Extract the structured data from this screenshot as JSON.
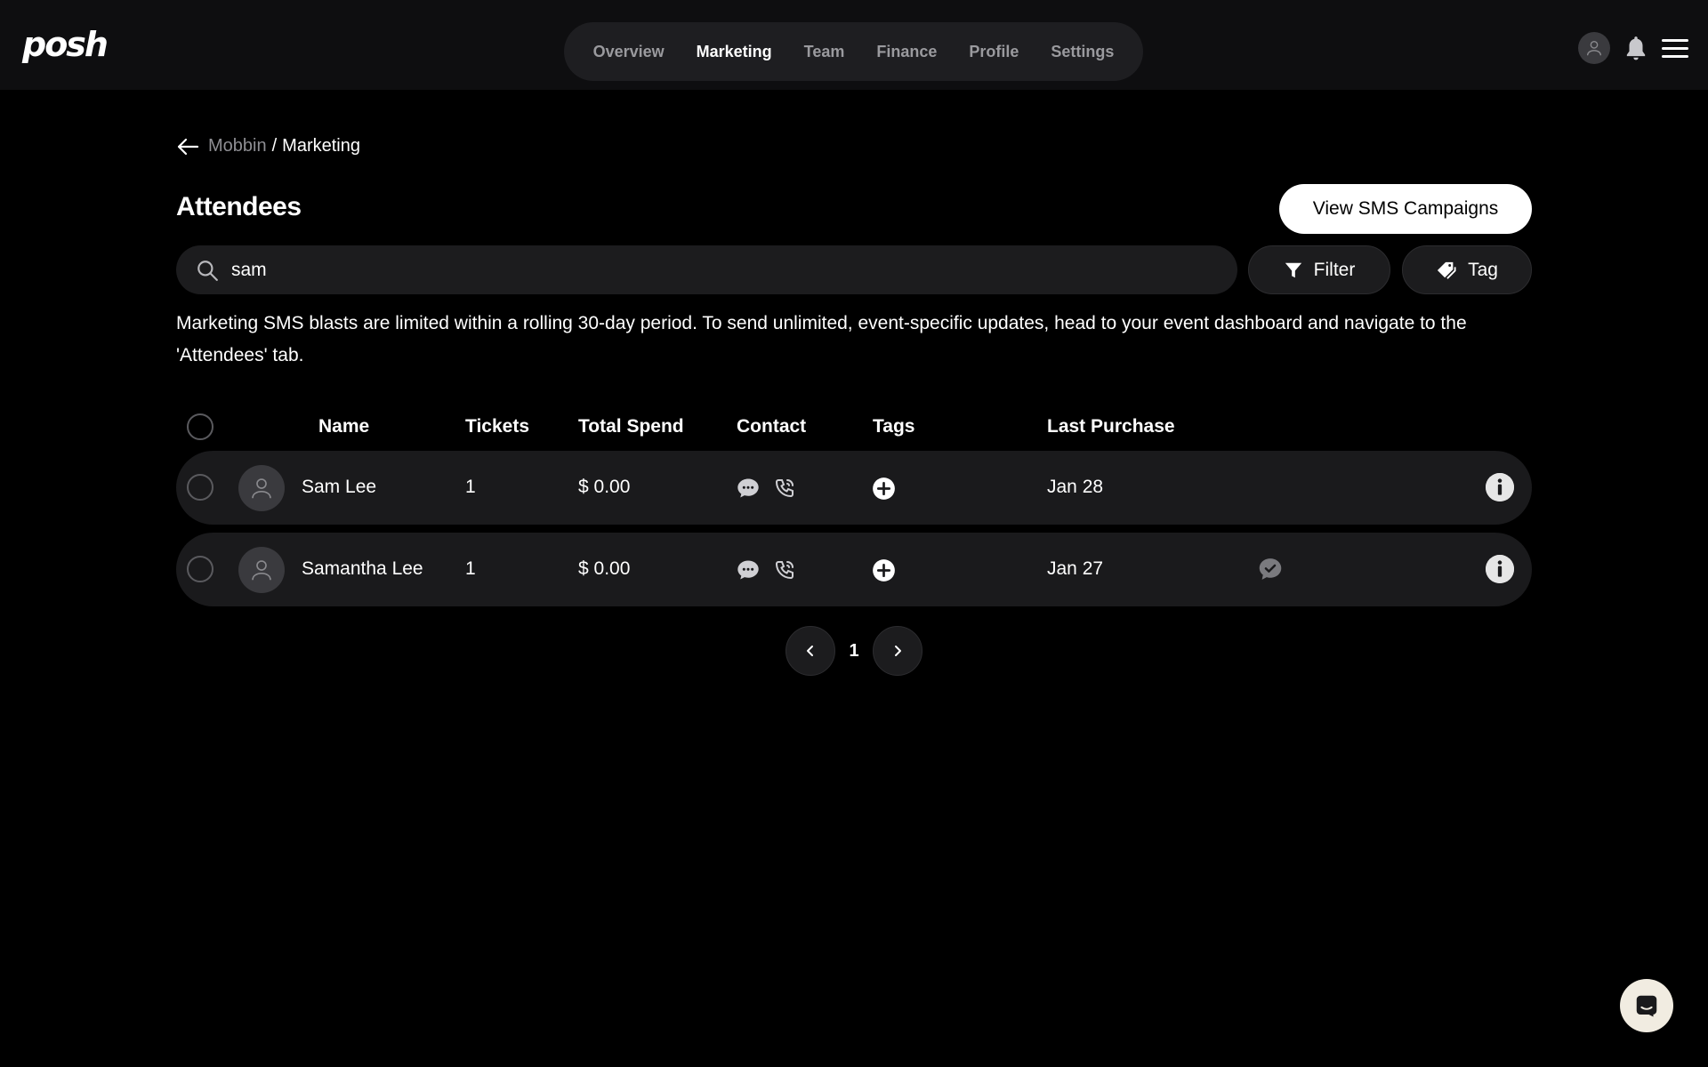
{
  "brand": {
    "logo_text": "posh"
  },
  "nav": {
    "items": [
      {
        "label": "Overview",
        "active": false
      },
      {
        "label": "Marketing",
        "active": true
      },
      {
        "label": "Team",
        "active": false
      },
      {
        "label": "Finance",
        "active": false
      },
      {
        "label": "Profile",
        "active": false
      },
      {
        "label": "Settings",
        "active": false
      }
    ]
  },
  "header_icons": [
    "user-avatar-icon",
    "bell-icon",
    "hamburger-menu-icon"
  ],
  "breadcrumb": {
    "parent": "Mobbin",
    "separator": "/",
    "current": "Marketing"
  },
  "page": {
    "title": "Attendees"
  },
  "actions": {
    "sms_campaigns_label": "View SMS Campaigns",
    "filter_label": "Filter",
    "tag_label": "Tag"
  },
  "search": {
    "value": "sam",
    "placeholder": ""
  },
  "notice": "Marketing SMS blasts are limited within a rolling 30-day period. To send unlimited, event-specific updates, head to your event dashboard and navigate to the 'Attendees' tab.",
  "table": {
    "columns": [
      "Name",
      "Tickets",
      "Total Spend",
      "Contact",
      "Tags",
      "Last Purchase"
    ],
    "rows": [
      {
        "name": "Sam Lee",
        "tickets": "1",
        "total_spend": "$ 0.00",
        "last_purchase": "Jan 28",
        "sms_status": false
      },
      {
        "name": "Samantha Lee",
        "tickets": "1",
        "total_spend": "$ 0.00",
        "last_purchase": "Jan 27",
        "sms_status": true
      }
    ]
  },
  "pagination": {
    "current_page": "1"
  },
  "colors": {
    "background": "#000000",
    "topbar": "#0e0e10",
    "surface": "#1a1a1c",
    "primary_button": "#ffffff",
    "chat_fab": "#f1ece1"
  }
}
